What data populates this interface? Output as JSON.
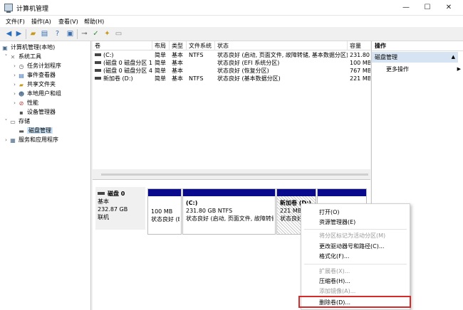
{
  "window": {
    "title": "计算机管理",
    "minimize": "—",
    "maximize": "☐",
    "close": "✕"
  },
  "menubar": [
    "文件(F)",
    "操作(A)",
    "查看(V)",
    "帮助(H)"
  ],
  "toolbar": {
    "icons": [
      "back-icon",
      "forward-icon",
      "up-folder-icon",
      "show-pane-icon",
      "help-icon",
      "properties-icon",
      "connect-icon",
      "check-icon",
      "new-item-icon",
      "export-icon"
    ]
  },
  "tree": [
    {
      "label": "计算机管理(本地)",
      "icon": "computer-icon",
      "level": 0,
      "expander": ""
    },
    {
      "label": "系统工具",
      "icon": "tools-icon",
      "level": 1,
      "expander": "˅"
    },
    {
      "label": "任务计划程序",
      "icon": "clock-icon",
      "level": 2,
      "expander": "›"
    },
    {
      "label": "事件查看器",
      "icon": "event-viewer-icon",
      "level": 2,
      "expander": "›"
    },
    {
      "label": "共享文件夹",
      "icon": "shared-folder-icon",
      "level": 2,
      "expander": "›"
    },
    {
      "label": "本地用户和组",
      "icon": "users-icon",
      "level": 2,
      "expander": "›"
    },
    {
      "label": "性能",
      "icon": "performance-icon",
      "level": 2,
      "expander": "›"
    },
    {
      "label": "设备管理器",
      "icon": "device-manager-icon",
      "level": 2,
      "expander": ""
    },
    {
      "label": "存储",
      "icon": "storage-icon",
      "level": 1,
      "expander": "˅"
    },
    {
      "label": "磁盘管理",
      "icon": "disk-management-icon",
      "level": 2,
      "expander": "",
      "selected": true
    },
    {
      "label": "服务和应用程序",
      "icon": "services-icon",
      "level": 1,
      "expander": "›"
    }
  ],
  "volumes": {
    "columns": [
      "卷",
      "布局",
      "类型",
      "文件系统",
      "状态",
      "容量"
    ],
    "rows": [
      [
        "(C:)",
        "简单",
        "基本",
        "NTFS",
        "状态良好 (启动, 页面文件, 故障转储, 基本数据分区)",
        "231.80"
      ],
      [
        "(磁盘 0 磁盘分区 1)",
        "简单",
        "基本",
        "",
        "状态良好 (EFI 系统分区)",
        "100 MB"
      ],
      [
        "(磁盘 0 磁盘分区 4)",
        "简单",
        "基本",
        "",
        "状态良好 (恢复分区)",
        "767 MB"
      ],
      [
        "新加卷 (D:)",
        "简单",
        "基本",
        "NTFS",
        "状态良好 (基本数据分区)",
        "221 MB"
      ]
    ]
  },
  "actions": {
    "header": "操作",
    "section": "磁盘管理",
    "section_arrow": "▲",
    "more": "更多操作",
    "more_arrow": "▶"
  },
  "disk": {
    "name": "磁盘 0",
    "type": "基本",
    "size": "232.87 GB",
    "state": "联机",
    "partitions": [
      {
        "title": "",
        "size": "100 MB",
        "status": "状态良好 (E"
      },
      {
        "title": "(C:)",
        "size": "231.80 GB NTFS",
        "status": "状态良好 (启动, 页面文件, 故障转储"
      },
      {
        "title": "新加卷 (D:)",
        "size": "221 MB",
        "status": "状态良好"
      },
      {
        "title": "",
        "size": "",
        "status": ""
      }
    ]
  },
  "context_menu": {
    "items": [
      {
        "label": "打开(O)",
        "enabled": true
      },
      {
        "label": "资源管理器(E)",
        "enabled": true
      },
      {
        "label": "将分区标记为活动分区(M)",
        "enabled": false
      },
      {
        "label": "更改驱动器号和路径(C)...",
        "enabled": true
      },
      {
        "label": "格式化(F)...",
        "enabled": true
      },
      {
        "label": "扩展卷(X)...",
        "enabled": false
      },
      {
        "label": "压缩卷(H)...",
        "enabled": true
      },
      {
        "label": "添加镜像(A)...",
        "enabled": false
      },
      {
        "label": "删除卷(D)...",
        "enabled": true,
        "highlighted": true
      }
    ]
  },
  "colors": {
    "partition_bar": "#0a0a8c",
    "selection": "#cce4f7",
    "action_section": "#d5e3f2",
    "highlight_box": "#d42b2b"
  }
}
